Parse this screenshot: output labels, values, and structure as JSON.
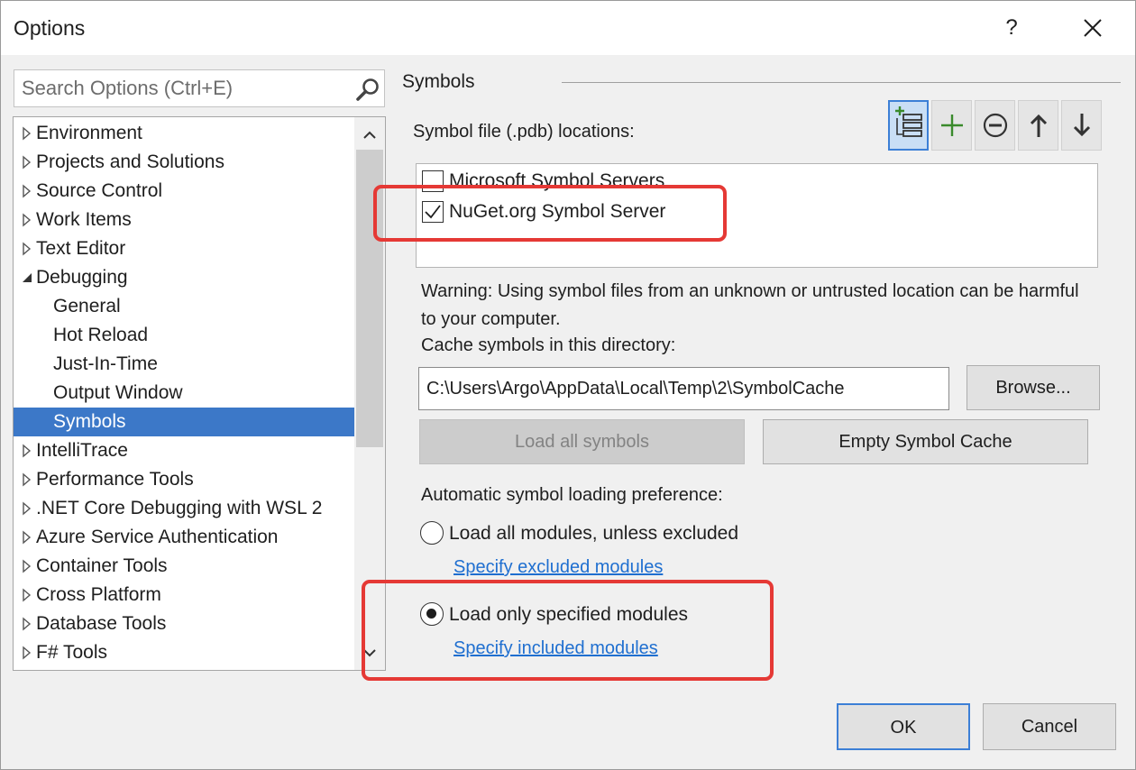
{
  "window": {
    "title": "Options",
    "help_label": "?"
  },
  "search": {
    "placeholder": "Search Options (Ctrl+E)"
  },
  "tree": {
    "items": [
      {
        "label": "Environment",
        "expandable": true,
        "expanded": false
      },
      {
        "label": "Projects and Solutions",
        "expandable": true,
        "expanded": false
      },
      {
        "label": "Source Control",
        "expandable": true,
        "expanded": false
      },
      {
        "label": "Work Items",
        "expandable": true,
        "expanded": false
      },
      {
        "label": "Text Editor",
        "expandable": true,
        "expanded": false
      },
      {
        "label": "Debugging",
        "expandable": true,
        "expanded": true
      },
      {
        "label": "General",
        "child": true
      },
      {
        "label": "Hot Reload",
        "child": true
      },
      {
        "label": "Just-In-Time",
        "child": true
      },
      {
        "label": "Output Window",
        "child": true
      },
      {
        "label": "Symbols",
        "child": true,
        "selected": true
      },
      {
        "label": "IntelliTrace",
        "expandable": true,
        "expanded": false
      },
      {
        "label": "Performance Tools",
        "expandable": true,
        "expanded": false
      },
      {
        "label": ".NET Core Debugging with WSL 2",
        "expandable": true,
        "expanded": false
      },
      {
        "label": "Azure Service Authentication",
        "expandable": true,
        "expanded": false
      },
      {
        "label": "Container Tools",
        "expandable": true,
        "expanded": false
      },
      {
        "label": "Cross Platform",
        "expandable": true,
        "expanded": false
      },
      {
        "label": "Database Tools",
        "expandable": true,
        "expanded": false
      },
      {
        "label": "F# Tools",
        "expandable": true,
        "expanded": false
      }
    ]
  },
  "panel": {
    "section_title": "Symbols",
    "locations_label": "Symbol file (.pdb) locations:",
    "toolbar": [
      "load-symbols-icon",
      "add-icon",
      "remove-icon",
      "move-up-icon",
      "move-down-icon"
    ],
    "locations": [
      {
        "label": "Microsoft Symbol Servers",
        "checked": false
      },
      {
        "label": "NuGet.org Symbol Server",
        "checked": true
      }
    ],
    "warning": "Warning: Using symbol files from an unknown or untrusted location can be harmful to your computer.",
    "cache_label": "Cache symbols in this directory:",
    "cache_path": "C:\\Users\\Argo\\AppData\\Local\\Temp\\2\\SymbolCache",
    "browse_label": "Browse...",
    "load_all_label": "Load all symbols",
    "empty_cache_label": "Empty Symbol Cache",
    "auto_label": "Automatic symbol loading preference:",
    "option_all": "Load all modules, unless excluded",
    "link_excluded": "Specify excluded modules",
    "option_specified": "Load only specified modules",
    "link_included": "Specify included modules",
    "selected_option": "specified"
  },
  "footer": {
    "ok_label": "OK",
    "cancel_label": "Cancel"
  },
  "colors": {
    "selection": "#3c78c8",
    "link": "#1f6fd0",
    "highlight": "#e53935"
  }
}
